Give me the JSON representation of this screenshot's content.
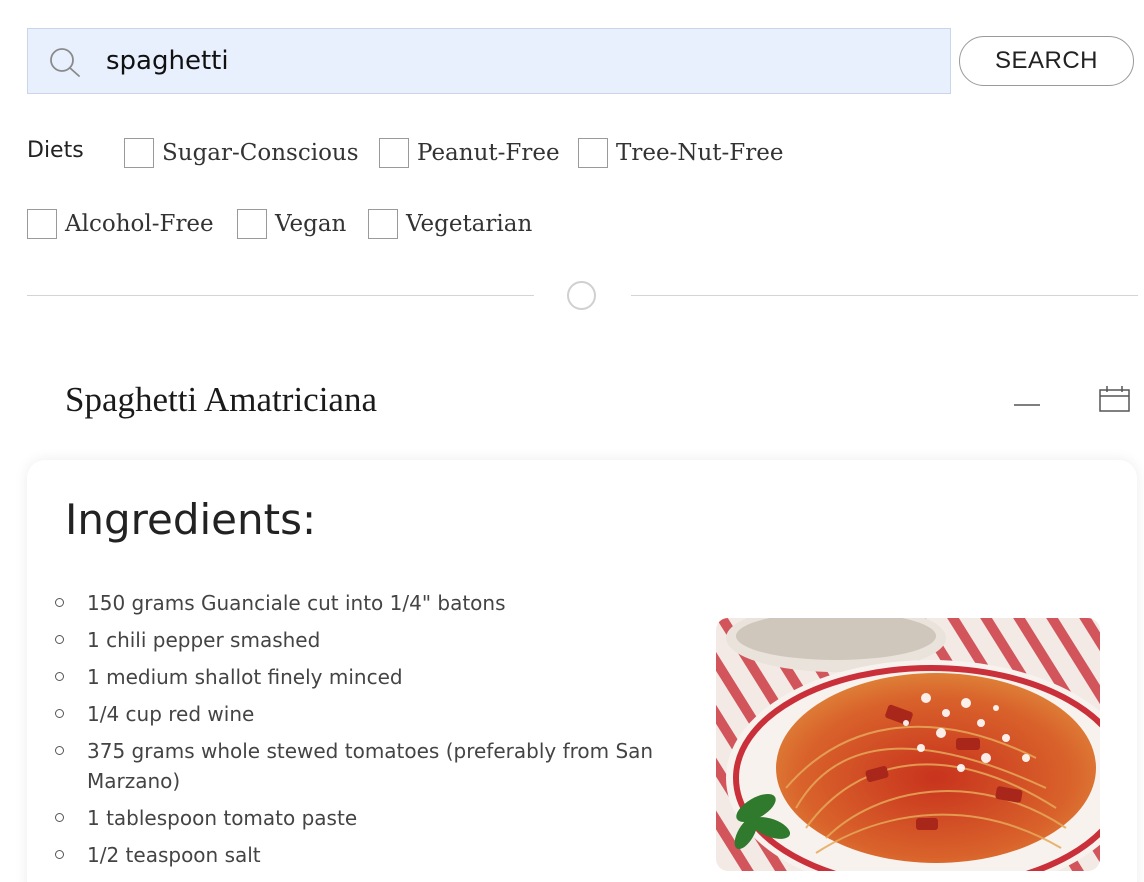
{
  "search": {
    "value": "spaghetti",
    "button_label": "SEARCH"
  },
  "diets": {
    "label": "Diets",
    "options": [
      {
        "label": "Sugar-Conscious",
        "checked": false
      },
      {
        "label": "Peanut-Free",
        "checked": false
      },
      {
        "label": "Tree-Nut-Free",
        "checked": false
      },
      {
        "label": "Alcohol-Free",
        "checked": false
      },
      {
        "label": "Vegan",
        "checked": false
      },
      {
        "label": "Vegetarian",
        "checked": false
      }
    ]
  },
  "recipe": {
    "title": "Spaghetti Amatriciana",
    "ingredients_heading": "Ingredients:",
    "ingredients": [
      "150 grams Guanciale cut into 1/4\" batons",
      "1 chili pepper smashed",
      "1 medium shallot finely minced",
      "1/4 cup red wine",
      "375 grams whole stewed tomatoes (preferably from San Marzano)",
      "1 tablespoon tomato paste",
      "1/2 teaspoon salt"
    ]
  },
  "icons": {
    "search": "search-icon",
    "minimize": "minimize-icon",
    "calendar": "calendar-icon",
    "divider": "circle-icon"
  },
  "colors": {
    "search_background": "#e8f0fd",
    "divider": "#d4d4d4"
  }
}
